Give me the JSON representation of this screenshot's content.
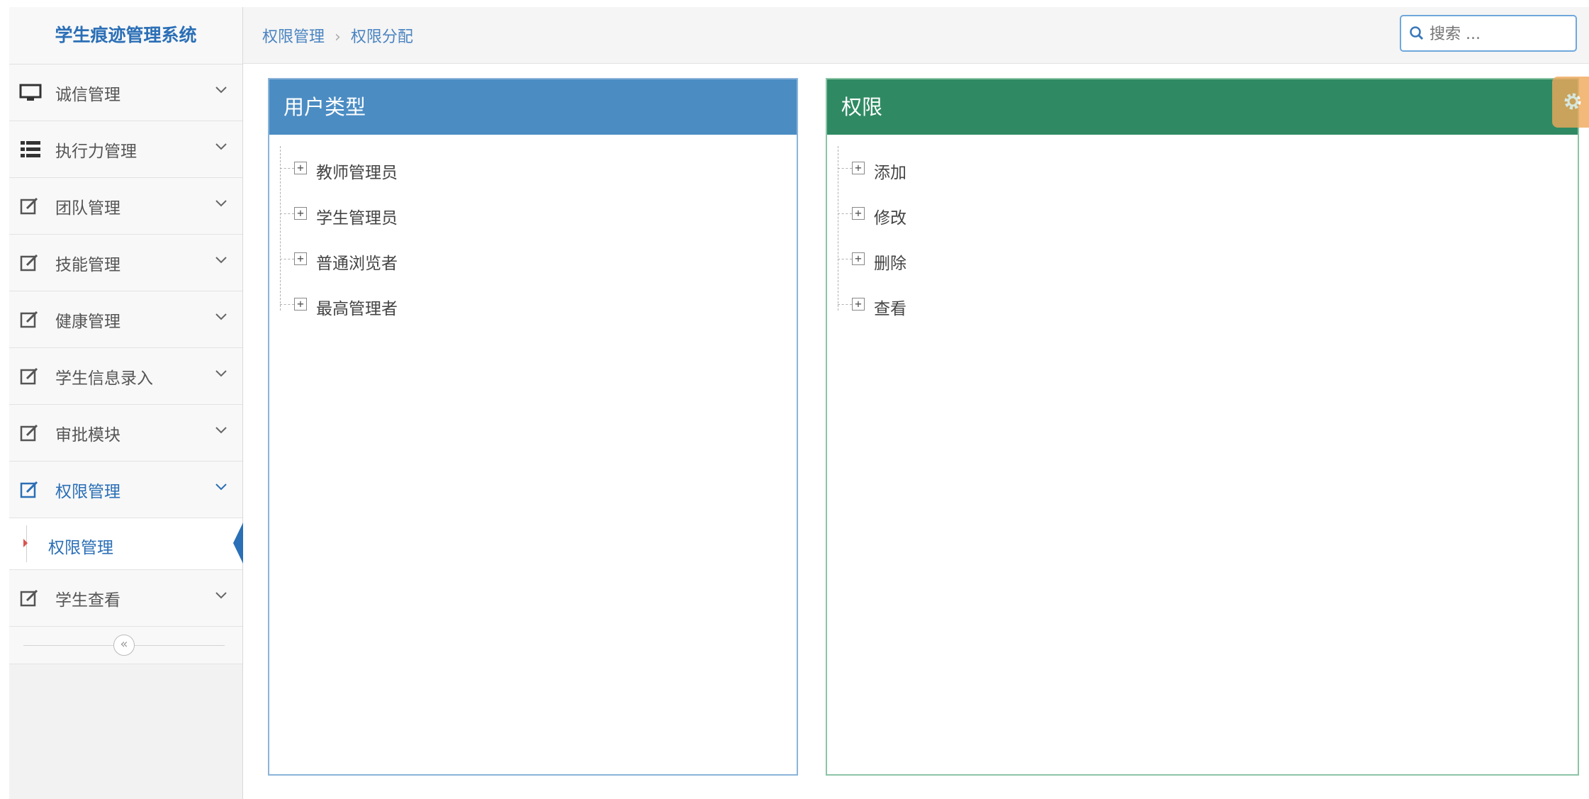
{
  "app": {
    "title": "学生痕迹管理系统"
  },
  "sidebar": {
    "items": [
      {
        "label": "诚信管理",
        "icon": "monitor-icon"
      },
      {
        "label": "执行力管理",
        "icon": "list-icon"
      },
      {
        "label": "团队管理",
        "icon": "edit-icon"
      },
      {
        "label": "技能管理",
        "icon": "edit-icon"
      },
      {
        "label": "健康管理",
        "icon": "edit-icon"
      },
      {
        "label": "学生信息录入",
        "icon": "edit-icon"
      },
      {
        "label": "审批模块",
        "icon": "edit-icon"
      },
      {
        "label": "权限管理",
        "icon": "edit-icon",
        "active": true
      },
      {
        "label": "学生查看",
        "icon": "edit-icon"
      }
    ],
    "sub_item": {
      "label": "权限管理"
    },
    "collapse_glyph": "«"
  },
  "breadcrumb": {
    "first": "权限管理",
    "separator": "›",
    "second": "权限分配"
  },
  "search": {
    "placeholder": "搜索 ..."
  },
  "panels": {
    "user_types": {
      "title": "用户类型",
      "items": [
        "教师管理员",
        "学生管理员",
        "普通浏览者",
        "最高管理者"
      ]
    },
    "permissions": {
      "title": "权限",
      "items": [
        "添加",
        "修改",
        "删除",
        "查看"
      ]
    }
  },
  "colors": {
    "brand": "#2b6fb6",
    "user_panel_header": "#4b8cc3",
    "perm_panel_header": "#2f8a63",
    "settings_tab": "#f0a85a"
  }
}
